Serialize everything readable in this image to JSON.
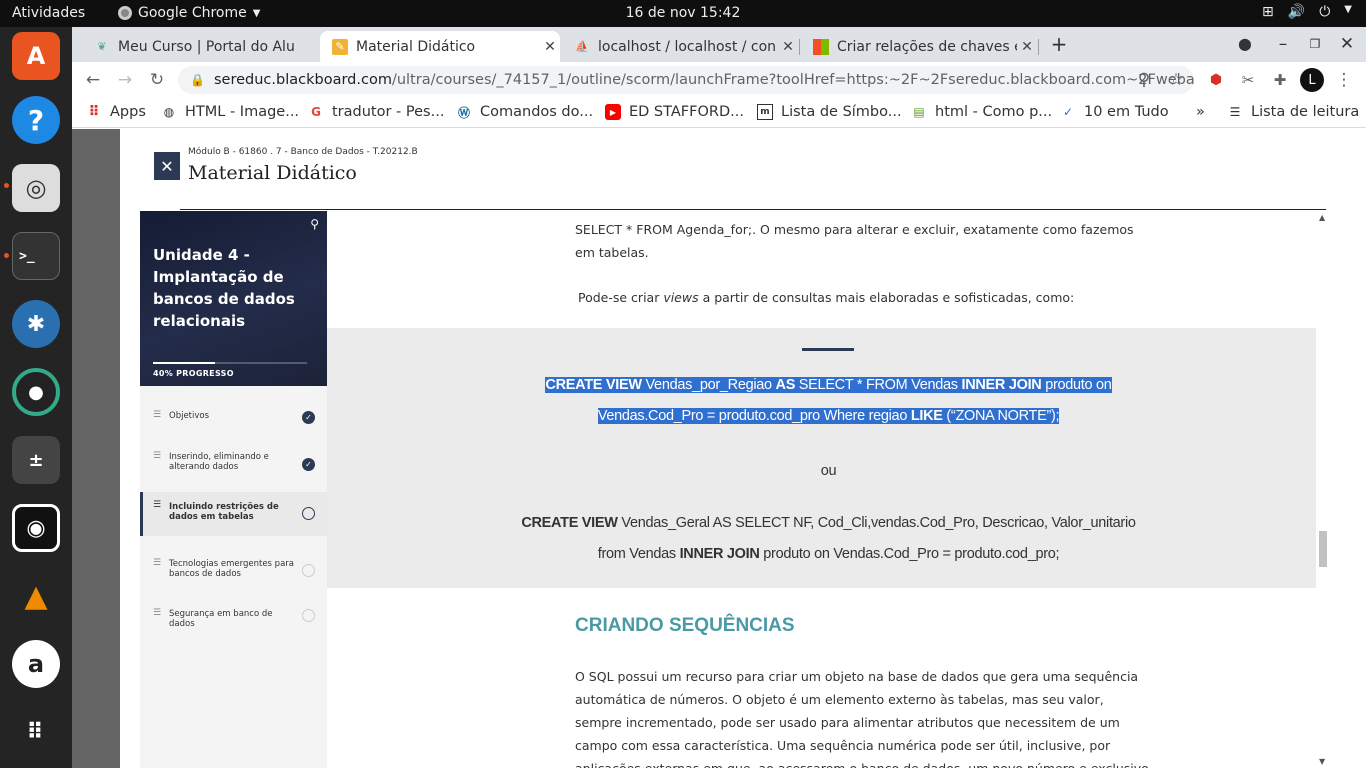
{
  "topbar": {
    "activities": "Atividades",
    "app": "Google Chrome",
    "clock": "16 de nov  15:42"
  },
  "tabs": [
    {
      "label": "Meu Curso | Portal do Alu",
      "icon": "leaf-icon"
    },
    {
      "label": "Material Didático",
      "icon": "pencil-icon",
      "active": true
    },
    {
      "label": "localhost / localhost / con",
      "icon": "phpmyadmin-icon"
    },
    {
      "label": "Criar relações de chaves e",
      "icon": "microsoft-icon"
    }
  ],
  "address": {
    "host": "sereduc.blackboard.com",
    "path": "/ultra/courses/_74157_1/outline/scorm/launchFrame?toolHref=https:~2F~2Fsereduc.blackboard.com~2Fwebapps~2Fs..."
  },
  "bookmarks": [
    {
      "label": "Apps",
      "icon": "apps-grid-icon"
    },
    {
      "label": "HTML - Image...",
      "icon": "globe-icon"
    },
    {
      "label": "tradutor - Pes...",
      "icon": "google-icon"
    },
    {
      "label": "Comandos do...",
      "icon": "wordpress-icon"
    },
    {
      "label": "ED STAFFORD...",
      "icon": "youtube-icon"
    },
    {
      "label": "Lista de Símbo...",
      "icon": "page-icon"
    },
    {
      "label": "html - Como p...",
      "icon": "stack-icon"
    },
    {
      "label": "10 em Tudo",
      "icon": "check-icon"
    }
  ],
  "bookmarks_more": "»",
  "reading_list": "Lista de leitura",
  "modal": {
    "breadcrumb": "Módulo B - 61860 . 7 - Banco de Dados - T.20212.B",
    "title": "Material Didático"
  },
  "sidebar": {
    "unit_title": "Unidade 4 - Implantação de bancos de dados relacionais",
    "progress_label": "40% PROGRESSO",
    "progress": 0.4,
    "items": [
      {
        "label": "Objetivos",
        "status": "done"
      },
      {
        "label": "Inserindo, eliminando e alterando dados",
        "status": "done"
      },
      {
        "label": "Incluindo restrições de dados em tabelas",
        "status": "current"
      },
      {
        "label": "Tecnologias emergentes para bancos de dados",
        "status": "todo"
      },
      {
        "label": "Segurança em banco de dados",
        "status": "todo"
      }
    ]
  },
  "content": {
    "p1a": "SELECT * FROM Agenda_for;. O mesmo para alterar e excluir, exatamente como fazemos",
    "p1b": "em tabelas.",
    "p2_pre": "Pode-se criar ",
    "p2_em": "views",
    "p2_post": " a partir de consultas mais elaboradas e sofisticadas, como:",
    "code1": {
      "kw1": "CREATE VIEW",
      "t1": " Vendas_por_Regiao ",
      "kw2": "AS",
      "t2": " SELECT * FROM Vendas ",
      "kw3": "INNER JOIN",
      "t3": " produto on",
      "t4": "Vendas.Cod_Pro = produto.cod_pro Where regiao ",
      "kw4": "LIKE",
      "t5": " (“ZONA NORTE”);"
    },
    "or": "ou",
    "code2": {
      "kw1": "CREATE VIEW",
      "t1": " Vendas_Geral AS SELECT NF, Cod_Cli,vendas.Cod_Pro, Descricao, Valor_unitario",
      "t2": "from Vendas ",
      "kw2": "INNER JOIN",
      "t3": " produto on Vendas.Cod_Pro = produto.cod_pro;"
    },
    "heading": "CRIANDO SEQUÊNCIAS",
    "p3": [
      "O SQL possui um recurso para criar um objeto na base de dados que gera uma sequência",
      "automática de números. O objeto é um elemento externo às tabelas, mas seu valor,",
      "sempre incrementado, pode ser usado para alimentar atributos que necessitem de um",
      "campo com essa característica. Uma sequência numérica pode ser útil, inclusive, por",
      "aplicações externas em que, ao acessarem o banco de dados, um novo número e exclusivo"
    ]
  }
}
